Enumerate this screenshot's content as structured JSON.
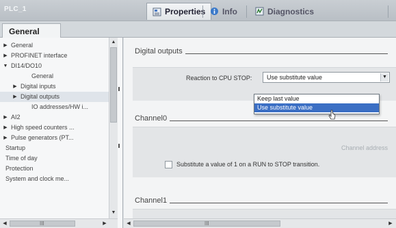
{
  "window": {
    "title": "PLC_1"
  },
  "tabs": [
    {
      "label": "Properties",
      "icon": "properties-icon",
      "active": true
    },
    {
      "label": "Info",
      "icon": "info-icon",
      "active": false
    },
    {
      "label": "Diagnostics",
      "icon": "diagnostics-icon",
      "active": false
    }
  ],
  "subtab": {
    "label": "General"
  },
  "nav": {
    "items": [
      {
        "label": "General",
        "level": 0,
        "arrow": "right"
      },
      {
        "label": "PROFINET interface",
        "level": 0,
        "arrow": "right"
      },
      {
        "label": "DI14/DO10",
        "level": 0,
        "arrow": "down"
      },
      {
        "label": "General",
        "level": 2,
        "arrow": ""
      },
      {
        "label": "Digital inputs",
        "level": 1,
        "arrow": "right"
      },
      {
        "label": "Digital outputs",
        "level": 1,
        "arrow": "right",
        "selected": true
      },
      {
        "label": "IO addresses/HW i...",
        "level": 2,
        "arrow": ""
      },
      {
        "label": "AI2",
        "level": 0,
        "arrow": "right"
      },
      {
        "label": "High speed counters ...",
        "level": 0,
        "arrow": "right"
      },
      {
        "label": "Pulse generators (PT...",
        "level": 0,
        "arrow": "right"
      },
      {
        "label": "Startup",
        "level": 0,
        "arrow": ""
      },
      {
        "label": "Time of day",
        "level": 0,
        "arrow": ""
      },
      {
        "label": "Protection",
        "level": 0,
        "arrow": ""
      },
      {
        "label": "System and clock me...",
        "level": 0,
        "arrow": ""
      }
    ]
  },
  "main": {
    "digital_outputs": {
      "title": "Digital outputs",
      "reaction_label": "Reaction to CPU STOP:",
      "reaction_value": "Use substitute value",
      "dropdown_options": [
        {
          "label": "Keep last value",
          "highlighted": false
        },
        {
          "label": "Use substitute value",
          "highlighted": true
        }
      ]
    },
    "channel0": {
      "title": "Channel0",
      "channel_address_label": "Channel address",
      "substitute_label": "Substitute a value of 1 on a RUN to STOP transition.",
      "substitute_checked": false
    },
    "channel1": {
      "title": "Channel1"
    }
  },
  "scrollbars": {
    "grip_glyph": "III"
  },
  "colors": {
    "highlight": "#3b6fc4",
    "panel": "#e3e5e7"
  }
}
